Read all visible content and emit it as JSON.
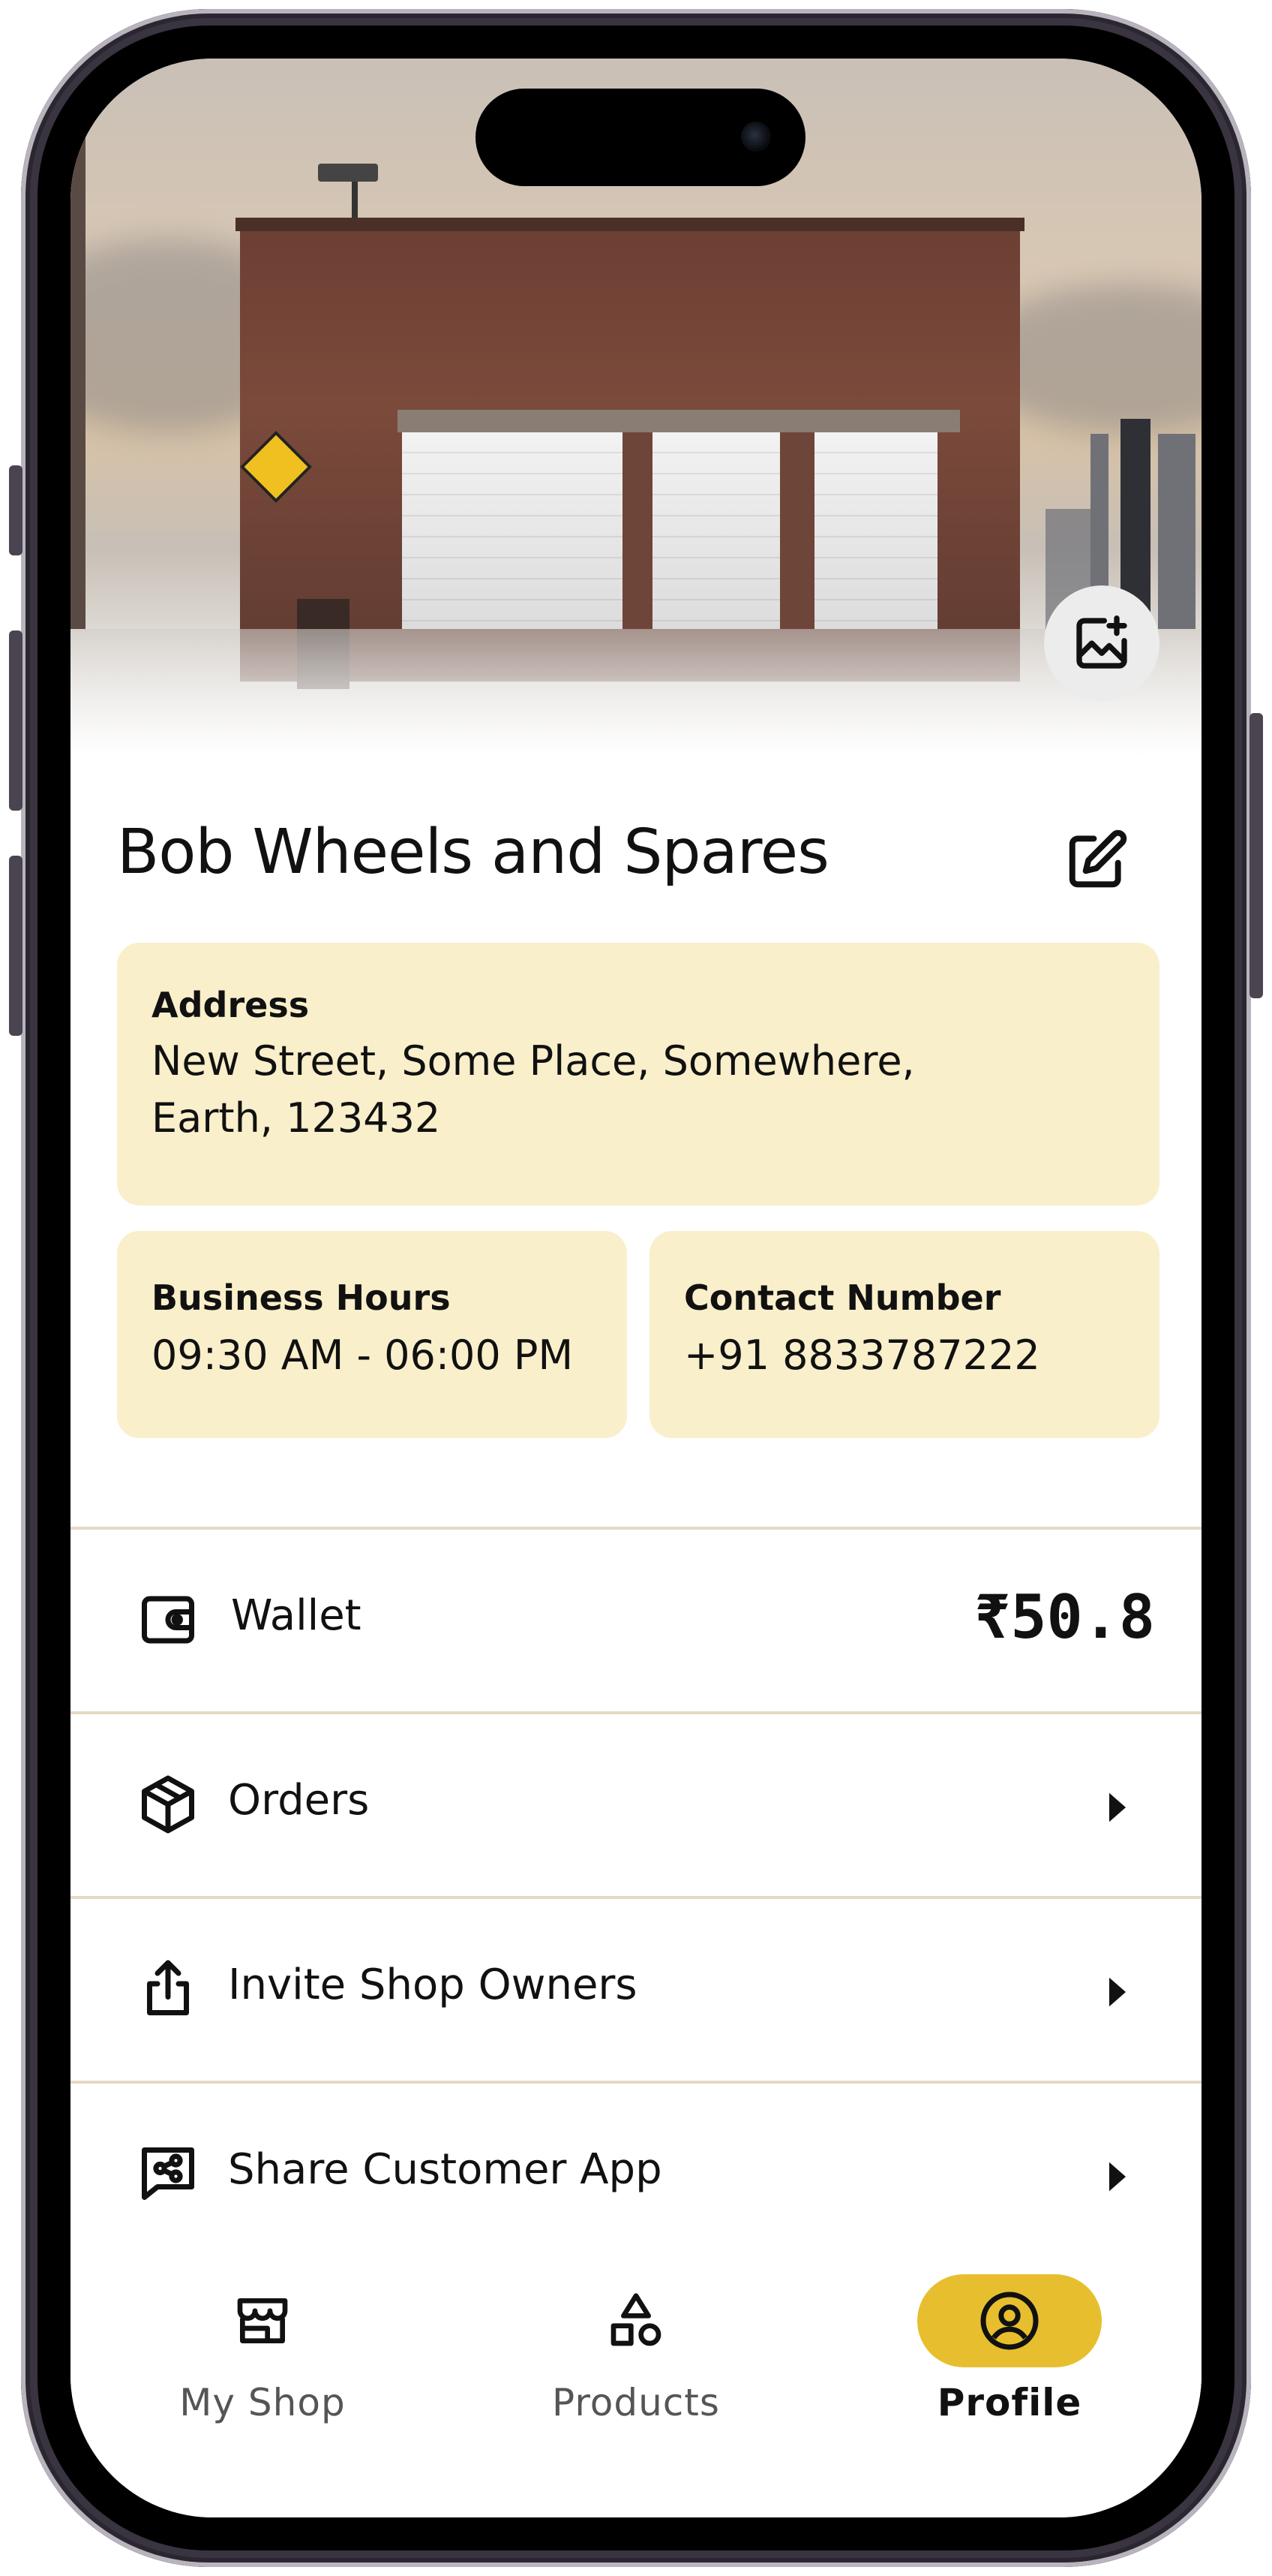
{
  "shop": {
    "name": "Bob Wheels and Spares"
  },
  "address": {
    "label": "Address",
    "value": "New Street, Some Place, Somewhere, Earth, 123432"
  },
  "hours": {
    "label": "Business Hours",
    "value": "09:30 AM - 06:00 PM"
  },
  "contact": {
    "label": "Contact Number",
    "value": "+91 8833787222"
  },
  "menu": {
    "wallet": {
      "label": "Wallet",
      "value": "₹50.8",
      "icon": "wallet-icon"
    },
    "orders": {
      "label": "Orders",
      "icon": "box-icon"
    },
    "invite": {
      "label": "Invite Shop Owners",
      "icon": "share-upload-icon"
    },
    "share_app": {
      "label": "Share Customer App",
      "icon": "share-chat-icon"
    }
  },
  "nav": {
    "items": [
      {
        "label": "My Shop",
        "icon": "store-icon",
        "active": false
      },
      {
        "label": "Products",
        "icon": "shapes-icon",
        "active": false
      },
      {
        "label": "Profile",
        "icon": "user-circle-icon",
        "active": true
      }
    ]
  },
  "colors": {
    "card_bg": "#f9efcb",
    "accent": "#e7bf2e",
    "divider": "#e4d9c4"
  }
}
